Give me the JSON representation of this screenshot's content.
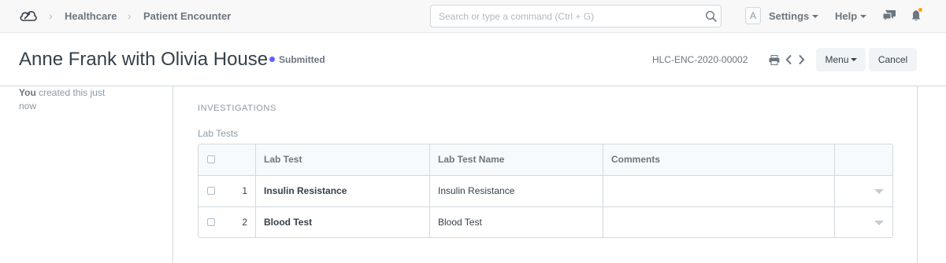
{
  "navbar": {
    "logo_icon": "cloud-logo-icon",
    "breadcrumbs": [
      "Healthcare",
      "Patient Encounter"
    ],
    "search_placeholder": "Search or type a command (Ctrl + G)",
    "search_icon": "search-icon",
    "avatar_letter": "A",
    "settings_label": "Settings",
    "help_label": "Help",
    "chat_icon": "chat-icon",
    "bell_icon": "bell-icon",
    "notification_color": "#ffa00a"
  },
  "page_head": {
    "title": "Anne Frank with Olivia House",
    "status": "Submitted",
    "status_color": "#5e64ff",
    "doc_name": "HLC-ENC-2020-00002",
    "menu_label": "Menu",
    "cancel_label": "Cancel"
  },
  "sidebar": {
    "timeline_actor": "You",
    "timeline_text": "created this just now"
  },
  "form": {
    "section_title": "INVESTIGATIONS",
    "lab_tests_label": "Lab Tests",
    "columns": [
      "Lab Test",
      "Lab Test Name",
      "Comments"
    ],
    "rows": [
      {
        "idx": "1",
        "lab_test": "Insulin Resistance",
        "lab_test_name": "Insulin Resistance",
        "comments": ""
      },
      {
        "idx": "2",
        "lab_test": "Blood Test",
        "lab_test_name": "Blood Test",
        "comments": ""
      }
    ]
  }
}
